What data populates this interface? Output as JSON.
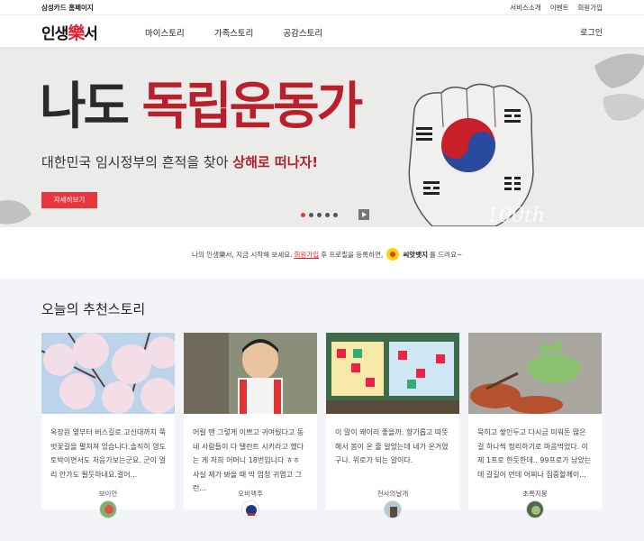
{
  "topbar": {
    "home_label": "삼성카드 홈페이지",
    "links": [
      "서비스소개",
      "이벤트",
      "회원가입"
    ]
  },
  "nav": {
    "logo_main": "인생",
    "logo_accent": "樂",
    "logo_tail": "서",
    "menu": [
      "마이스토리",
      "가족스토리",
      "공감스토리"
    ],
    "login": "로그인"
  },
  "hero": {
    "title_plain": "나도 ",
    "title_accent": "독립운동가",
    "subtitle_plain": "대한민국 임시정부의 흔적을 찾아 ",
    "subtitle_em": "상해로 떠나자!",
    "cta": "자세히보기",
    "slide_count": 5,
    "active_slide": 1,
    "watermark": "100th",
    "colors": {
      "accent": "#e8363f",
      "title_red": "#b8202b"
    }
  },
  "notice": {
    "before": "나의 인생樂서, 지금 시작해 보세요.",
    "link": "회원가입",
    "middle": "후 프로필을 등록하면,",
    "badge_name": "씨앗뱃지",
    "after": "를 드려요~"
  },
  "stories": {
    "heading": "오늘의 추천스토리",
    "cards": [
      {
        "excerpt": "옥장원 옆부터 버스길로 고신대까지 쭉 벗꽃길을 펼쳐져 있습니다.솔직히 영도 토박이면서도 처음가보는군요. 군이 멀리 안가도 될듯하네요.걸어...",
        "author": "보이안",
        "photo": "cherry-blossom"
      },
      {
        "excerpt": "어릴 땐 그렇게 이쁘고 귀여웠다고 동네 사람들이 다 탤런트 시키라고 했다는 게 저희 어머니 18번입니다 ㅎㅎ 사실 제가 봐을 때 막 엄청 귀엽고 그런...",
        "author": "오비맥주",
        "photo": "child"
      },
      {
        "excerpt": "이 말이 왜이리 좋을까. 향기롭고 따뜻해서 봄이 온 줄 알았는데 네가 온거였구나. 위로가 되는 말이다.",
        "author": "천사의날개",
        "photo": "board"
      },
      {
        "excerpt": "묵히고 쌓인두고 다시금 미워돈 많은 걸 하나씩 정리하기로 마음먹었다. 이제 1프로 한듯한데.. 99프로가 남았는데 갈길이 먼데 어찌나 집중할께이...",
        "author": "초록지붕",
        "photo": "street-art"
      }
    ]
  }
}
